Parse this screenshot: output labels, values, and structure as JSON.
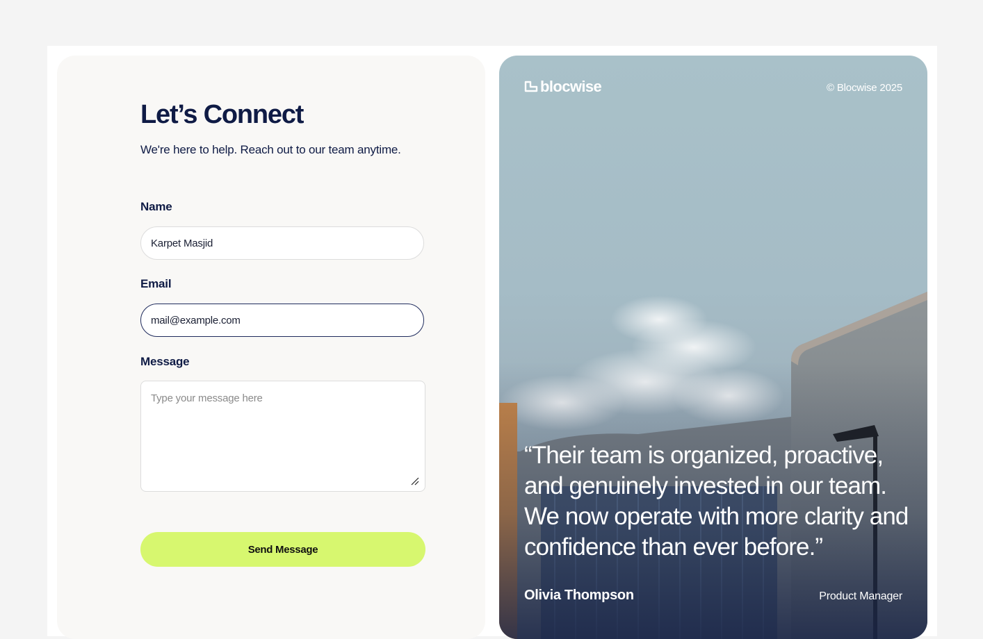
{
  "form": {
    "title": "Let’s Connect",
    "subtitle": "We're here to help. Reach out to our team anytime.",
    "name_label": "Name",
    "name_value": "Karpet Masjid",
    "email_label": "Email",
    "email_value": "mail@example.com",
    "message_label": "Message",
    "message_placeholder": "Type your message here",
    "send_label": "Send Message",
    "accent_color": "#d7f76f",
    "text_color": "#0f1b45"
  },
  "hero": {
    "brand": "blocwise",
    "copyright": "© Blocwise 2025",
    "quote": "“Their team is organized, proactive, and genuinely invested in our team. We now operate with more clarity and confidence than ever before.”",
    "author": "Olivia Thompson",
    "role": "Product Manager"
  }
}
